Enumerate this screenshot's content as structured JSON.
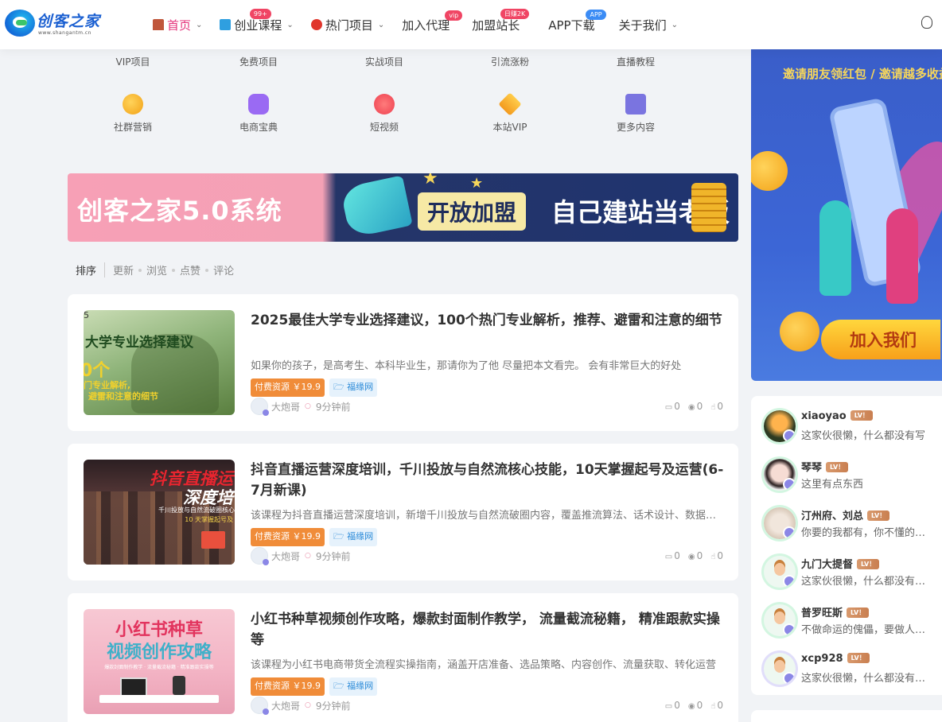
{
  "site": {
    "logo_text": "创客之家",
    "logo_sub": "www.shangantm.cn"
  },
  "nav": {
    "items": [
      {
        "label": "首页",
        "active": true,
        "chevron": true,
        "badge": ""
      },
      {
        "label": "创业课程",
        "chevron": true,
        "badge": "99+"
      },
      {
        "label": "热门项目",
        "chevron": true,
        "badge": ""
      },
      {
        "label": "加入代理",
        "chevron": false,
        "badge": "vip"
      },
      {
        "label": "加盟站长",
        "chevron": false,
        "badge": "日赚2K"
      },
      {
        "label": "APP下载",
        "chevron": false,
        "badge": "APP"
      },
      {
        "label": "关于我们",
        "chevron": true,
        "badge": ""
      }
    ],
    "theme_icon": "lightbulb-icon"
  },
  "categories_row1": [
    "VIP项目",
    "免费项目",
    "实战项目",
    "引流涨粉",
    "直播教程"
  ],
  "categories_row2": [
    {
      "label": "社群营销",
      "icon": "coins-icon",
      "color": "#f5b22b"
    },
    {
      "label": "电商宝典",
      "icon": "shopping-bag-icon",
      "color": "#8f5bf0"
    },
    {
      "label": "短视频",
      "icon": "flame-icon",
      "color": "#f2565f"
    },
    {
      "label": "本站VIP",
      "icon": "diamond-icon",
      "color": "#f5a623"
    },
    {
      "label": "更多内容",
      "icon": "book-icon",
      "color": "#6b65d8"
    }
  ],
  "banner": {
    "left_text": "创客之家5.0系统",
    "badge_text": "开放加盟",
    "right_text": "自己建站当老板"
  },
  "sort": {
    "lead": "排序",
    "options": [
      "更新",
      "浏览",
      "点赞",
      "评论"
    ]
  },
  "posts": [
    {
      "title": "2025最佳大学专业选择建议，100个热门专业解析，推荐、避雷和注意的细节",
      "desc": "如果你的孩子，是高考生、本科毕业生，那请你为了他 尽量把本文看完。 会有非常巨大的好处",
      "thumb_title": "大学专业选择建议",
      "thumb_sub1": "0个",
      "thumb_sub2": "门专业解析,",
      "thumb_sub3": "避雷和注意的细节",
      "thumb_letter": "5",
      "price_tag": "付费资源 ￥19.9",
      "category": "🗁 福缘网",
      "author": "大炮哥",
      "time": "9分钟前",
      "comments": "0",
      "views": "0",
      "likes": "0"
    },
    {
      "title": "抖音直播运营深度培训，千川投放与自然流核心技能，10天掌握起号及运营(6-7月新课)",
      "desc": "该课程为抖音直播运营深度培训，新增千川投放与自然流破圈内容，覆盖推流算法、话术设计、数据分析",
      "thumb_title": "抖音直播运",
      "thumb_title2": "深度培",
      "thumb_sub1": "千川投放与自然流破圈核心",
      "thumb_sub2": "10 天掌握起号及",
      "price_tag": "付费资源 ￥19.9",
      "category": "🗁 福缘网",
      "author": "大炮哥",
      "time": "9分钟前",
      "comments": "0",
      "views": "0",
      "likes": "0"
    },
    {
      "title": "小红书种草视频创作攻略，爆款封面制作教学， 流量截流秘籍， 精准跟款实操等",
      "desc": "该课程为小红书电商带货全流程实操指南，涵盖开店准备、选品策略、内容创作、流量获取、转化运营",
      "thumb_title": "小红书种草",
      "thumb_title2": "视频创作攻略",
      "thumb_sub1": "爆款封面制作教学 · 流量截流秘籍 · 精准跟款实操等",
      "price_tag": "付费资源 ￥19.9",
      "category": "🗁 福缘网",
      "author": "大炮哥",
      "time": "9分钟前",
      "comments": "0",
      "views": "0",
      "likes": "0"
    }
  ],
  "side_ad": {
    "title": "邀请朋友领红包 / 邀请越多收益",
    "join": "加入我们"
  },
  "users": [
    {
      "name": "xiaoyao",
      "level": "LV！",
      "sig": "这家伙很懒，什么都没有写",
      "avatar": "photo1"
    },
    {
      "name": "琴琴",
      "level": "LV！",
      "sig": "这里有点东西",
      "avatar": "photo2"
    },
    {
      "name": "汀州府、刘总",
      "level": "LV！",
      "sig": "你要的我都有，你不懂的我都懂",
      "avatar": "photo3"
    },
    {
      "name": "九门大提督",
      "level": "LV！",
      "sig": "这家伙很懒，什么都没有写...",
      "avatar": "def"
    },
    {
      "name": "普罗旺斯",
      "level": "LV！",
      "sig": "不做命运的傀儡，要做人生的主人",
      "avatar": "def"
    },
    {
      "name": "xcp928",
      "level": "LV！",
      "sig": "这家伙很懒，什么都没有写...",
      "avatar": "def"
    }
  ]
}
